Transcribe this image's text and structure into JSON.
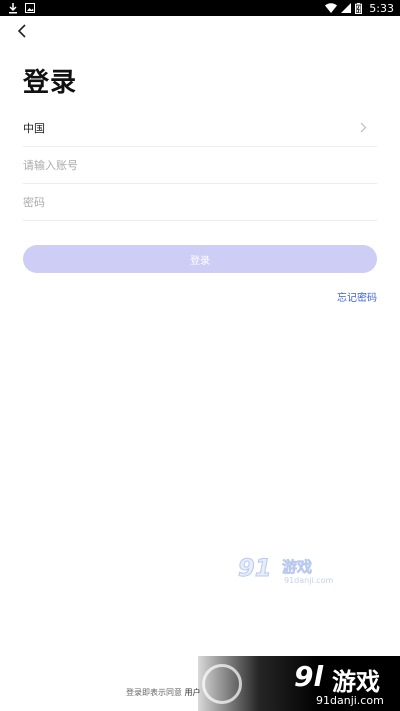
{
  "status_bar": {
    "time": "5:33"
  },
  "page": {
    "title": "登录"
  },
  "form": {
    "country_label": "中国",
    "account_placeholder": "请输入账号",
    "password_placeholder": "密码",
    "login_button": "登录",
    "forgot_password": "忘记密码"
  },
  "footer": {
    "agreement_prefix": "登录即表示同意",
    "agreement_link": "用户"
  },
  "watermark": {
    "center_mark": "91",
    "center_name": "游戏",
    "center_url": "91danji.com",
    "bottom_mark": "9l",
    "bottom_name": "游戏",
    "bottom_url": "91danji.com"
  },
  "colors": {
    "button_bg": "#cdcdf5",
    "link": "#3d63d9",
    "status_bar_bg": "#000000"
  },
  "icons": [
    "download-icon",
    "image-icon",
    "wifi-icon",
    "signal-icon",
    "battery-icon",
    "back-arrow-icon",
    "chevron-right-icon"
  ]
}
